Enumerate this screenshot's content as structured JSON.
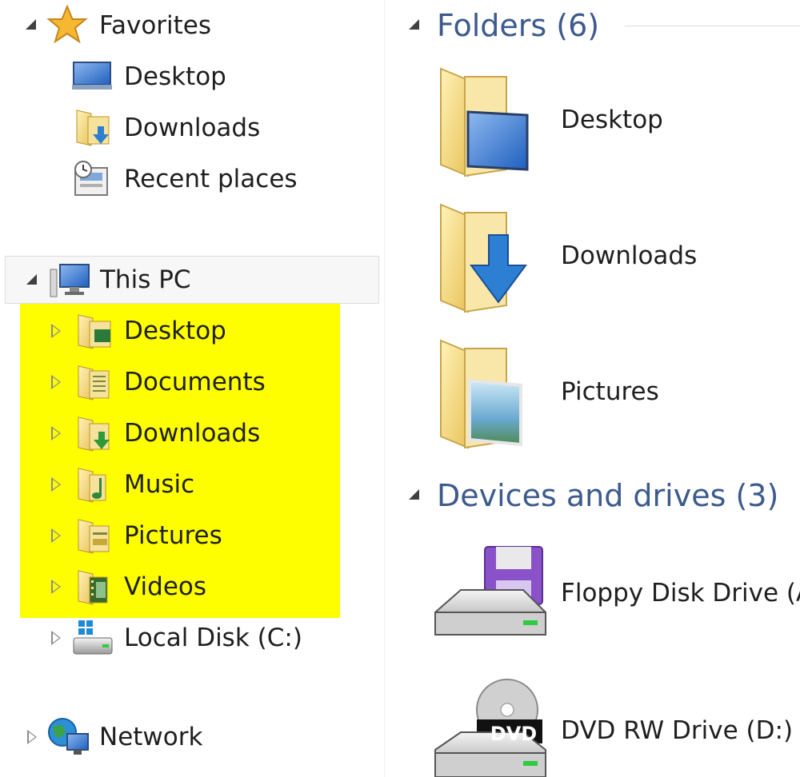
{
  "nav": {
    "favorites": {
      "label": "Favorites",
      "items": [
        {
          "label": "Desktop",
          "icon": "desktop-icon"
        },
        {
          "label": "Downloads",
          "icon": "downloads-folder-icon"
        },
        {
          "label": "Recent places",
          "icon": "recent-places-icon"
        }
      ]
    },
    "this_pc": {
      "label": "This PC",
      "items": [
        {
          "label": "Desktop",
          "icon": "desktop-folder-icon"
        },
        {
          "label": "Documents",
          "icon": "documents-folder-icon"
        },
        {
          "label": "Downloads",
          "icon": "downloads-folder-icon"
        },
        {
          "label": "Music",
          "icon": "music-folder-icon"
        },
        {
          "label": "Pictures",
          "icon": "pictures-folder-icon"
        },
        {
          "label": "Videos",
          "icon": "videos-folder-icon"
        },
        {
          "label": "Local Disk (C:)",
          "icon": "local-disk-icon"
        }
      ]
    },
    "network": {
      "label": "Network",
      "icon": "network-icon"
    }
  },
  "content": {
    "folders": {
      "title": "Folders (6)",
      "items": [
        {
          "label": "Desktop",
          "icon": "desktop-folder-icon"
        },
        {
          "label": "Downloads",
          "icon": "downloads-folder-icon"
        },
        {
          "label": "Pictures",
          "icon": "pictures-folder-icon"
        }
      ]
    },
    "devices": {
      "title": "Devices and drives (3)",
      "items": [
        {
          "label": "Floppy Disk Drive (A:)",
          "icon": "floppy-drive-icon"
        },
        {
          "label": "DVD RW Drive (D:)",
          "icon": "dvd-drive-icon"
        }
      ]
    },
    "dvd_badge": "DVD"
  },
  "colors": {
    "highlight": "#fefe00",
    "section_title": "#3c5a8c",
    "folder_yellow": "#f4d67a",
    "accent_blue": "#2c7fd3"
  }
}
